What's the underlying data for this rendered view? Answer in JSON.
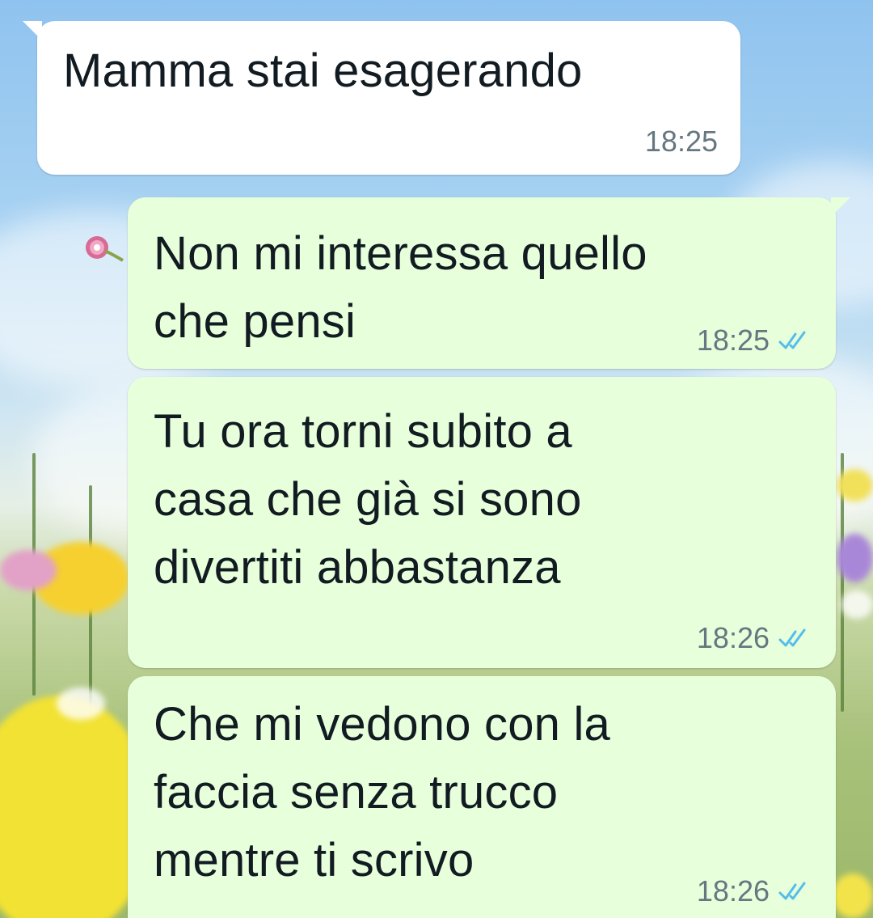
{
  "messages": [
    {
      "direction": "incoming",
      "text": "Mamma stai esagerando",
      "time": "18:25"
    },
    {
      "direction": "outgoing",
      "text": "Non mi interessa quello\nche pensi",
      "time": "18:25",
      "status": "read"
    },
    {
      "direction": "outgoing",
      "text": "Tu ora torni subito a\ncasa che già si sono\ndivertiti abbastanza",
      "time": "18:26",
      "status": "read"
    },
    {
      "direction": "outgoing",
      "text": "Che mi vedono con la\nfaccia senza trucco\nmentre ti scrivo",
      "time": "18:26",
      "status": "read"
    }
  ],
  "colors": {
    "incoming_bubble": "#ffffff",
    "outgoing_bubble": "#e7ffdb",
    "text": "#111b21",
    "timestamp": "#667781",
    "read_ticks": "#53bdeb"
  },
  "icons": {
    "read_receipt": "double-check-icon",
    "sticker": "flower-icon"
  }
}
